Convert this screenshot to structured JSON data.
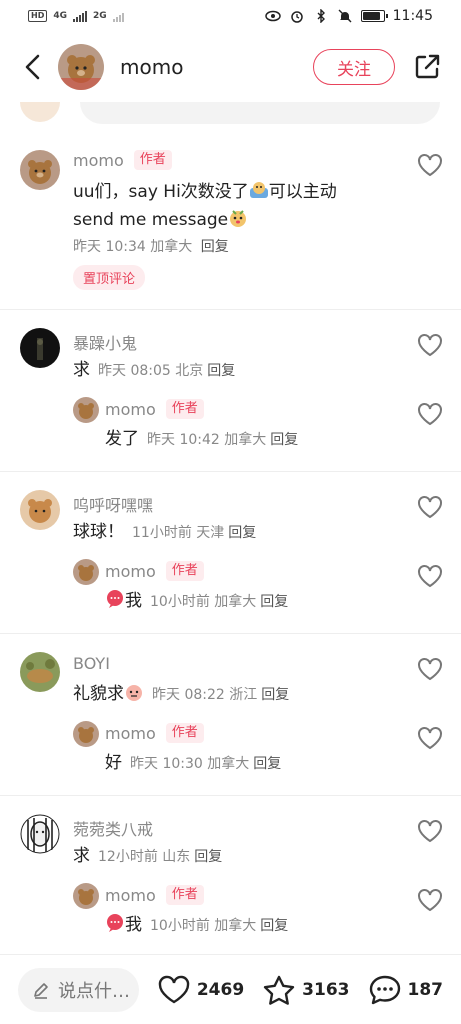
{
  "statusbar": {
    "left_hd": "HD",
    "left_net1": "4G",
    "left_net2": "2G",
    "time": "11:45"
  },
  "header": {
    "back_icon": "chevron-left-icon",
    "name": "momo",
    "follow_label": "关注",
    "share_icon": "share-icon"
  },
  "comments": [
    {
      "name": "momo",
      "author_tag": "作者",
      "text_line1": "uu们，say Hi次数没了",
      "text_line1_after": "可以主动",
      "text_line2": "send me message",
      "meta": "昨天 10:34 加拿大",
      "reply": "回复",
      "pin": "置顶评论"
    },
    {
      "name": "暴躁小鬼",
      "text": "求",
      "meta": "昨天 08:05 北京",
      "reply": "回复",
      "sub": {
        "name": "momo",
        "author_tag": "作者",
        "text": "发了",
        "meta": "昨天 10:42 加拿大",
        "reply": "回复"
      }
    },
    {
      "name": "呜呼呀嘿嘿",
      "text": "球球！",
      "meta": "11小时前  天津",
      "reply": "回复",
      "sub": {
        "name": "momo",
        "author_tag": "作者",
        "text": "我",
        "meta": "10小时前  加拿大",
        "reply": "回复"
      }
    },
    {
      "name": "BOYI",
      "text": "礼貌求",
      "meta": "昨天 08:22 浙江",
      "reply": "回复",
      "sub": {
        "name": "momo",
        "author_tag": "作者",
        "text": "好",
        "meta": "昨天 10:30 加拿大",
        "reply": "回复"
      }
    },
    {
      "name": "菀菀类八戒",
      "text": "求",
      "meta": "12小时前  山东",
      "reply": "回复",
      "sub": {
        "name": "momo",
        "author_tag": "作者",
        "text": "我",
        "meta": "10小时前  加拿大",
        "reply": "回复"
      }
    }
  ],
  "bottombar": {
    "placeholder": "说点什…",
    "likes": "2469",
    "stars": "3163",
    "comments": "187"
  },
  "colors": {
    "accent": "#e8435b",
    "accent_bg": "#fdecee",
    "muted": "#888888"
  }
}
